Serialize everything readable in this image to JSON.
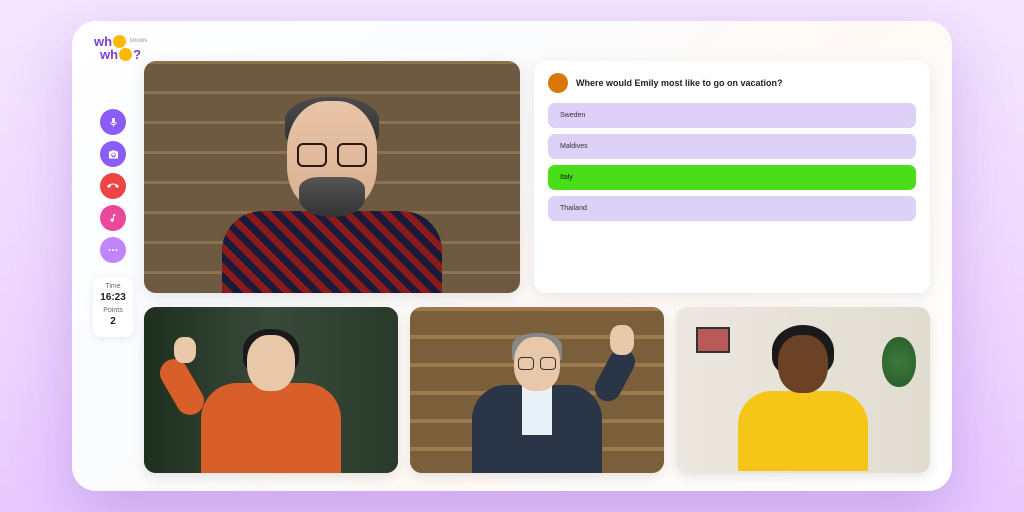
{
  "logo": {
    "line1": "wh",
    "knows": "knows",
    "line2": "wh",
    "suffix": "?"
  },
  "sidebar": {
    "time_label": "Time",
    "time_value": "16:23",
    "points_label": "Points",
    "points_value": "2"
  },
  "quiz": {
    "question": "Where would Emily most like to go on vacation?",
    "options": [
      "Sweden",
      "Maldives",
      "Italy",
      "Thailand"
    ],
    "selected_index": 2
  }
}
